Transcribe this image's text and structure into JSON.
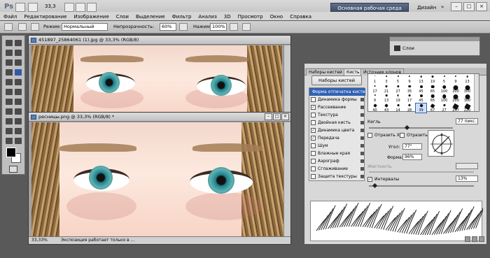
{
  "app": {
    "logo": "Ps",
    "zoom": "33,3",
    "workspace_active": "Основная рабочая среда",
    "workspace_design": "Дизайн",
    "workspace_more": "»"
  },
  "menu": [
    "Файл",
    "Редактирование",
    "Изображение",
    "Слои",
    "Выделение",
    "Фильтр",
    "Анализ",
    "3D",
    "Просмотр",
    "Окно",
    "Справка"
  ],
  "options": {
    "mode_label": "Режим:",
    "mode_value": "Нормальный",
    "opacity_label": "Непрозрачность:",
    "opacity_value": "60%",
    "flow_label": "Нажим:",
    "flow_value": "100%"
  },
  "doc1": {
    "title": "451897_25864061 (1).jpg @ 33,3% (RGB/8)"
  },
  "doc2": {
    "title": "ресницы.png @ 33,3% (RGB/8) *",
    "zoom": "33,33%",
    "status": "Экспозиция работает только в ..."
  },
  "layers_panel": {
    "label": "Слои"
  },
  "brush_panel": {
    "tabs": [
      "Наборы кистей",
      "Кисть",
      "Источник клонов"
    ],
    "presets_button": "Наборы кистей",
    "items": [
      {
        "label": "Форма отпечатка кисти",
        "checked": false,
        "selected": true
      },
      {
        "label": "Динамика формы",
        "checked": false
      },
      {
        "label": "Рассеивание",
        "checked": true
      },
      {
        "label": "Текстура",
        "checked": false
      },
      {
        "label": "Двойная кисть",
        "checked": false
      },
      {
        "label": "Динамика цвета",
        "checked": true
      },
      {
        "label": "Передача",
        "checked": true
      },
      {
        "label": "Шум",
        "checked": false
      },
      {
        "label": "Влажные края",
        "checked": false
      },
      {
        "label": "Аэрограф",
        "checked": false
      },
      {
        "label": "Сглаживание",
        "checked": false
      },
      {
        "label": "Защита текстуры",
        "checked": false
      }
    ],
    "tip_rows": [
      [
        "1",
        "3",
        "5",
        "9",
        "13",
        "19",
        "5",
        "9",
        "13"
      ],
      [
        "17",
        "21",
        "27",
        "35",
        "45",
        "65",
        "100",
        "200",
        "300"
      ],
      [
        "9",
        "13",
        "19",
        "17",
        "45",
        "65",
        "100",
        "200",
        "300"
      ],
      [
        "40",
        "43",
        "14",
        "28",
        "39",
        "67",
        "27",
        "247",
        "220"
      ]
    ],
    "size_label": "Кегль",
    "size_value": "77 пикс.",
    "flip_x": "Отразить X",
    "flip_y": "Отразить Y",
    "angle_label": "Угол:",
    "angle_value": "77°",
    "roundness_label": "Форма:",
    "roundness_value": "96%",
    "hardness_label": "Жесткость",
    "spacing_label": "Интервалы",
    "spacing_value": "13%",
    "spacing_checked": true
  },
  "colors": {
    "accent": "#3162b2",
    "workspace_btn": "#4a5a78",
    "foreground": "#000000",
    "background": "#ffffff",
    "iris": "#2f8f92"
  }
}
